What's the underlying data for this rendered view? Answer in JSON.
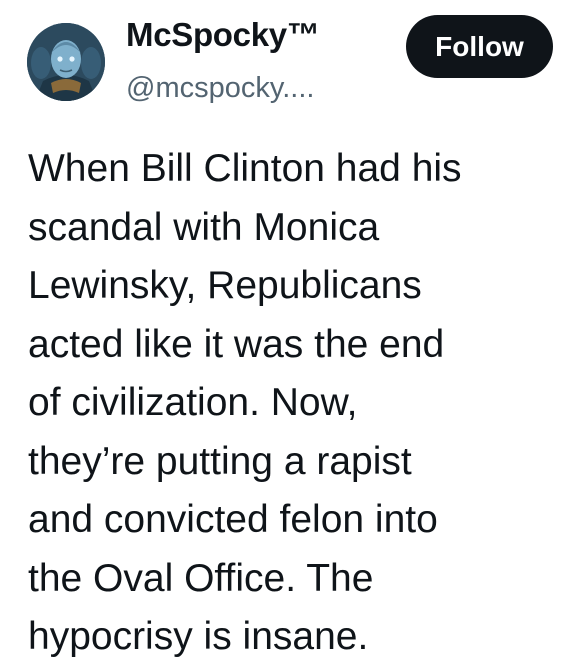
{
  "author": {
    "display_name": "McSpocky™",
    "handle": "@mcspocky...."
  },
  "follow_button": {
    "label": "Follow"
  },
  "tweet": {
    "lines": [
      "When Bill Clinton had his",
      "scandal with Monica",
      "Lewinsky, Republicans",
      "acted like it was the end",
      "of civilization. Now,",
      "they’re putting a rapist",
      "and convicted felon into",
      "the Oval Office. The",
      "hypocrisy is insane."
    ]
  },
  "colors": {
    "text": "#0f1419",
    "secondary_text": "#536471",
    "button_bg": "#0f1419",
    "button_text": "#ffffff",
    "background": "#ffffff"
  }
}
